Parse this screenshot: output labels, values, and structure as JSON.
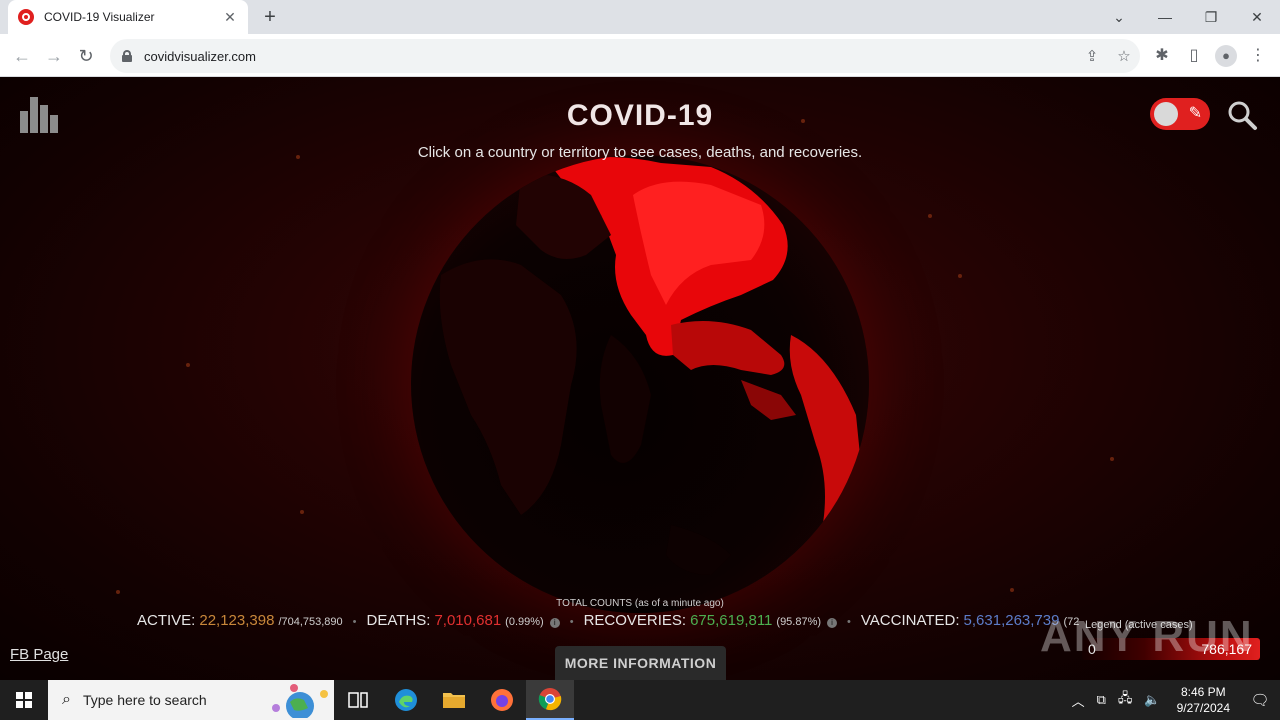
{
  "browser": {
    "tab_title": "COVID-19 Visualizer",
    "url": "covidvisualizer.com",
    "new_tab": "+",
    "tab_close": "✕"
  },
  "page": {
    "title": "COVID-19",
    "subtitle": "Click on a country or territory to see cases, deaths, and recoveries.",
    "totals_caption": "TOTAL COUNTS (as of a minute ago)",
    "stats": {
      "active_label": "ACTIVE:",
      "active_value": "22,123,398",
      "active_sub": "/704,753,890",
      "deaths_label": "DEATHS:",
      "deaths_value": "7,010,681",
      "deaths_sub": "(0.99%)",
      "recoveries_label": "RECOVERIES:",
      "recoveries_value": "675,619,811",
      "recoveries_sub": "(95.87%)",
      "vaccinated_label": "VACCINATED:",
      "vaccinated_value": "5,631,263,739",
      "vaccinated_sub": "(72"
    },
    "legend": {
      "label": "Legend (active cases)",
      "min": "0",
      "max": "786,167"
    },
    "fb_link": "FB Page",
    "more_info": "MORE INFORMATION",
    "watermark": "ANY RUN"
  },
  "taskbar": {
    "search_placeholder": "Type here to search",
    "time": "8:46 PM",
    "date": "9/27/2024"
  },
  "colors": {
    "accent_red": "#e0201f",
    "active": "#c8873a",
    "deaths": "#e03030",
    "recoveries": "#4caf50",
    "vaccinated": "#5c7cc8"
  }
}
